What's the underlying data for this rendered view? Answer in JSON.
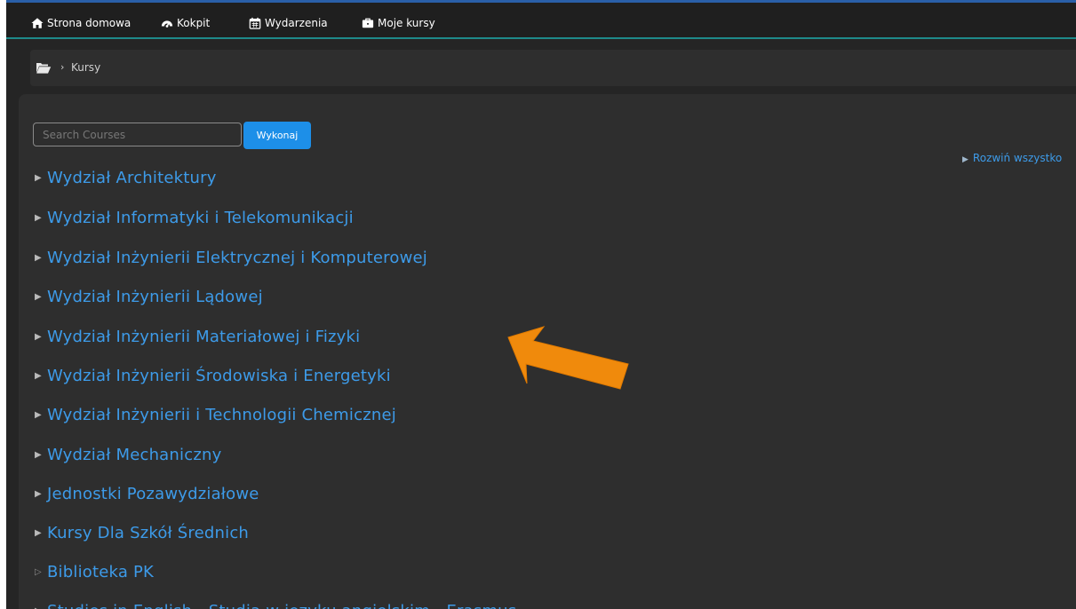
{
  "nav": {
    "items": [
      {
        "label": "Strona domowa",
        "icon": "home-icon"
      },
      {
        "label": "Kokpit",
        "icon": "dashboard-icon"
      },
      {
        "label": "Wydarzenia",
        "icon": "calendar-icon"
      },
      {
        "label": "Moje kursy",
        "icon": "briefcase-icon"
      }
    ]
  },
  "breadcrumb": {
    "icon": "folder-open-icon",
    "separator": "›",
    "current": "Kursy"
  },
  "search": {
    "placeholder": "Search Courses",
    "value": "",
    "button_label": "Wykonaj"
  },
  "expand_all": {
    "label": "Rozwiń wszystko"
  },
  "categories": [
    {
      "label": "Wydział Architektury",
      "indicator": "filled"
    },
    {
      "label": "Wydział Informatyki i Telekomunikacji",
      "indicator": "filled"
    },
    {
      "label": "Wydział Inżynierii Elektrycznej i Komputerowej",
      "indicator": "filled"
    },
    {
      "label": "Wydział Inżynierii Lądowej",
      "indicator": "filled"
    },
    {
      "label": "Wydział Inżynierii Materiałowej i Fizyki",
      "indicator": "filled"
    },
    {
      "label": "Wydział Inżynierii Środowiska i Energetyki",
      "indicator": "filled"
    },
    {
      "label": "Wydział Inżynierii i Technologii Chemicznej",
      "indicator": "filled"
    },
    {
      "label": "Wydział Mechaniczny",
      "indicator": "filled"
    },
    {
      "label": "Jednostki Pozawydziałowe",
      "indicator": "filled"
    },
    {
      "label": "Kursy Dla Szkół Średnich",
      "indicator": "filled"
    },
    {
      "label": "Biblioteka PK",
      "indicator": "hollow"
    },
    {
      "label": "Studies in English - Studia w języku angielskim - Erasmus",
      "indicator": "filled"
    }
  ],
  "colors": {
    "link": "#3d9be9",
    "button": "#1d8fe8",
    "annotation_arrow": "#f08a0c"
  }
}
